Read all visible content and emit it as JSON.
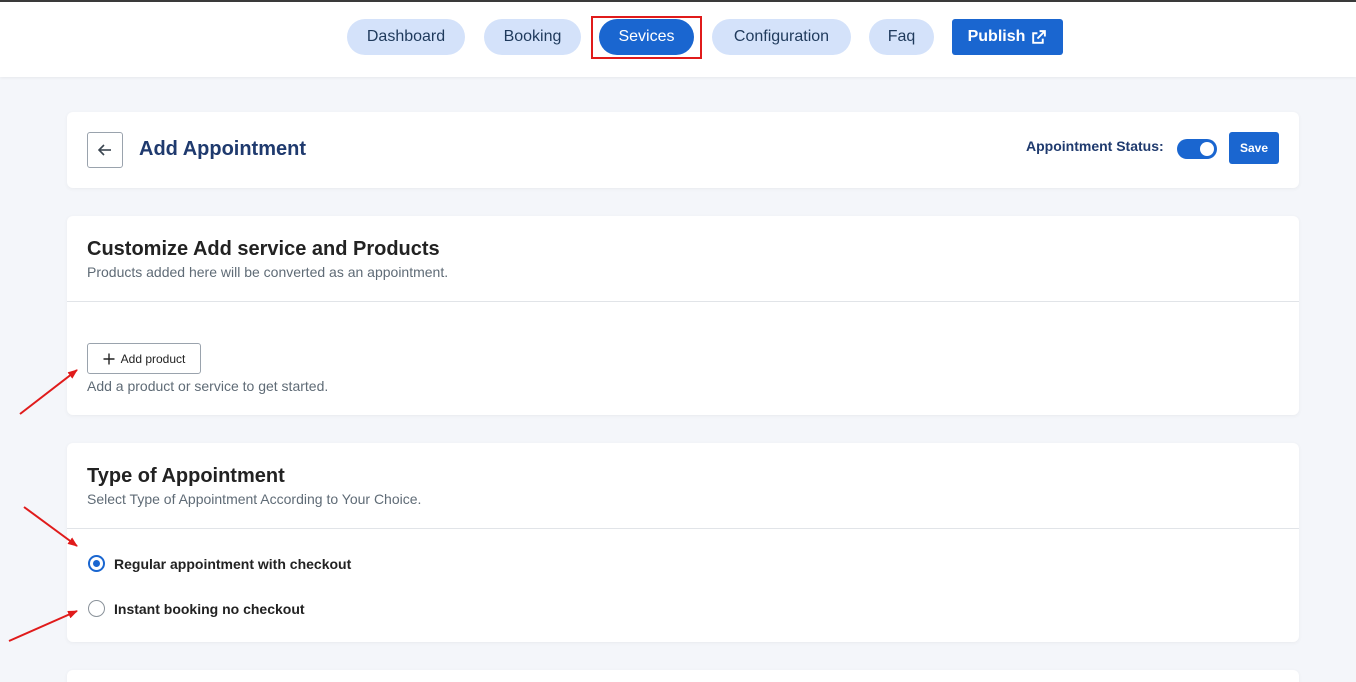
{
  "nav": {
    "items": [
      {
        "label": "Dashboard"
      },
      {
        "label": "Booking"
      },
      {
        "label": "Sevices"
      },
      {
        "label": "Configuration"
      },
      {
        "label": "Faq"
      }
    ],
    "active_item": "Sevices",
    "publish_label": "Publish",
    "publish_icon": "external-link-icon"
  },
  "header": {
    "title": "Add Appointment",
    "back_icon": "arrow-left-icon",
    "status_label": "Appointment Status:",
    "status_enabled": true,
    "save_label": "Save"
  },
  "products": {
    "title": "Customize Add service and Products",
    "subtitle": "Products added here will be converted as an appointment.",
    "add_button_label": "Add product",
    "add_button_icon": "plus-icon",
    "helper_text": "Add a product or service to get started."
  },
  "appointment_type": {
    "title": "Type of Appointment",
    "subtitle": "Select Type of Appointment According to Your Choice.",
    "options": [
      {
        "label": "Regular appointment with checkout",
        "selected": true
      },
      {
        "label": "Instant booking no checkout",
        "selected": false
      }
    ]
  },
  "colors": {
    "primary": "#1a66d0",
    "pill_background": "#d4e2fa",
    "annotation_red": "#e01b1b",
    "title_blue": "#1f3a6e",
    "page_background": "#f4f6fa"
  }
}
